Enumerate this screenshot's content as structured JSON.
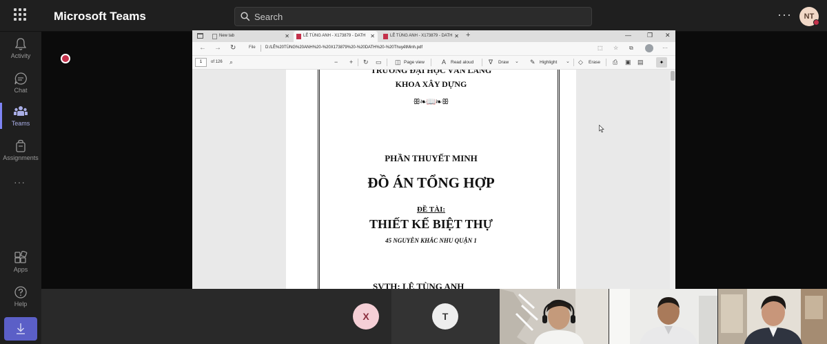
{
  "app": {
    "title": "Microsoft Teams"
  },
  "search": {
    "placeholder": "Search"
  },
  "header": {
    "more": "···",
    "avatar_initials": "NT"
  },
  "rail": {
    "items": [
      {
        "label": "Activity",
        "icon": "bell-icon"
      },
      {
        "label": "Chat",
        "icon": "chat-icon"
      },
      {
        "label": "Teams",
        "icon": "teams-icon"
      },
      {
        "label": "Assignments",
        "icon": "assignments-icon"
      },
      {
        "label": "Apps",
        "icon": "apps-icon"
      },
      {
        "label": "Help",
        "icon": "help-icon"
      }
    ],
    "more": "···"
  },
  "browser": {
    "tabs": [
      {
        "label": "New tab"
      },
      {
        "label": "LÊ TÙNG ANH - X173879 - DATH"
      },
      {
        "label": "LÊ TÙNG ANH - X173879 - DATH"
      }
    ],
    "address": {
      "scheme": "File",
      "url": "D:/LÊ%20TÙNG%20ANH%20-%20X173879%20-%20DATH%20-%20ThuyếtMinh.pdf"
    },
    "pdf_toolbar": {
      "page_number": "1",
      "page_count": "of 126",
      "page_view": "Page view",
      "read_aloud": "Read aloud",
      "draw": "Draw",
      "highlight": "Highlight",
      "erase": "Erase"
    }
  },
  "document": {
    "university": "TRƯỜNG ĐẠI HỌC VĂN LANG",
    "faculty": "KHOA XÂY DỰNG",
    "ornament": "ꕥ❧📖❧ꕥ",
    "section": "PHẦN THUYẾT MINH",
    "project": "ĐỒ ÁN TỔNG HỢP",
    "topic_label": "ĐỀ TÀI:",
    "topic": "THIẾT KẾ BIỆT THỰ",
    "address": "45 NGUYỄN KHẮC NHU QUẬN 1",
    "student": "SVTH: LÊ TÙNG ANH"
  },
  "participants": [
    {
      "initial": "X",
      "color": "#f5cfd6",
      "text_color": "#8a2c3c"
    },
    {
      "initial": "T",
      "color": "#eeeeee",
      "text_color": "#3a3a3a"
    }
  ]
}
